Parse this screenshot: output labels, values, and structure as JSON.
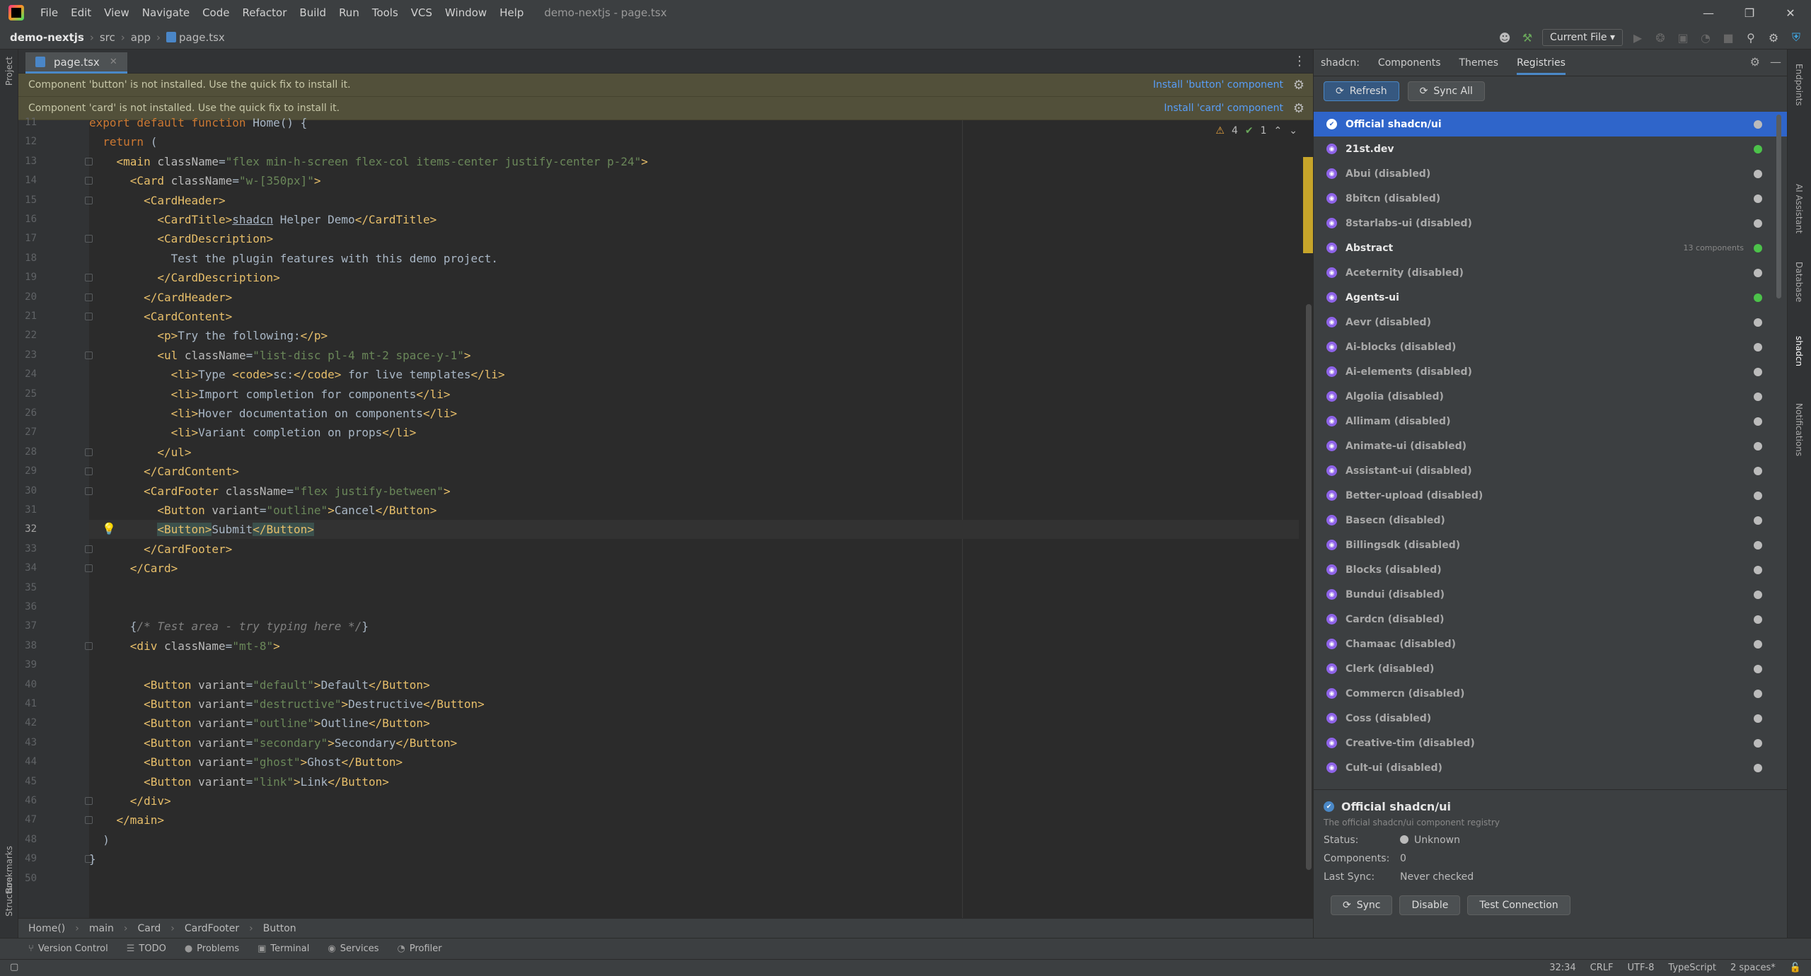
{
  "titlebar": {
    "menu": [
      "File",
      "Edit",
      "View",
      "Navigate",
      "Code",
      "Refactor",
      "Build",
      "Run",
      "Tools",
      "VCS",
      "Window",
      "Help"
    ],
    "title": "demo-nextjs - page.tsx"
  },
  "navbar": {
    "project": "demo-nextjs",
    "path": [
      "src",
      "app"
    ],
    "file": "page.tsx",
    "run_config": "Current File"
  },
  "left_strip": {
    "project": "Project",
    "bookmarks": "Bookmarks",
    "structure": "Structure"
  },
  "editor": {
    "tab": "page.tsx",
    "warnings": [
      {
        "text": "Component 'button' is not installed. Use the quick fix to install it.",
        "action": "Install 'button' component"
      },
      {
        "text": "Component 'card' is not installed. Use the quick fix to install it.",
        "action": "Install 'card' component"
      }
    ],
    "inspections": {
      "warnings": "4",
      "ok": "1"
    },
    "current_line": "32",
    "lines": [
      {
        "n": "11",
        "html": "<span class='kw'>export default function</span> <span class='tx'>Home() {</span>"
      },
      {
        "n": "12",
        "html": "  <span class='kw'>return</span> <span class='tx'>(</span>"
      },
      {
        "n": "13",
        "html": "    <span class='tg'>&lt;main</span> <span class='at'>className</span>=<span class='st'>\"flex min-h-screen flex-col items-center justify-center p-24\"</span><span class='tg'>&gt;</span>"
      },
      {
        "n": "14",
        "html": "      <span class='tg'>&lt;Card</span> <span class='at'>className</span>=<span class='st'>\"w-[350px]\"</span><span class='tg'>&gt;</span>"
      },
      {
        "n": "15",
        "html": "        <span class='tg'>&lt;CardHeader&gt;</span>"
      },
      {
        "n": "16",
        "html": "          <span class='tg'>&lt;CardTitle&gt;</span><span class='tx'><u>shadcn</u> Helper Demo</span><span class='tg'>&lt;/CardTitle&gt;</span>"
      },
      {
        "n": "17",
        "html": "          <span class='tg'>&lt;CardDescription&gt;</span>"
      },
      {
        "n": "18",
        "html": "            <span class='tx'>Test the plugin features with this demo project.</span>"
      },
      {
        "n": "19",
        "html": "          <span class='tg'>&lt;/CardDescription&gt;</span>"
      },
      {
        "n": "20",
        "html": "        <span class='tg'>&lt;/CardHeader&gt;</span>"
      },
      {
        "n": "21",
        "html": "        <span class='tg'>&lt;CardContent&gt;</span>"
      },
      {
        "n": "22",
        "html": "          <span class='tg'>&lt;p&gt;</span><span class='tx'>Try the following:</span><span class='tg'>&lt;/p&gt;</span>"
      },
      {
        "n": "23",
        "html": "          <span class='tg'>&lt;ul</span> <span class='at'>className</span>=<span class='st'>\"list-disc pl-4 mt-2 space-y-1\"</span><span class='tg'>&gt;</span>"
      },
      {
        "n": "24",
        "html": "            <span class='tg'>&lt;li&gt;</span><span class='tx'>Type </span><span class='tg'>&lt;code&gt;</span><span class='tx'>sc:</span><span class='tg'>&lt;/code&gt;</span><span class='tx'> for live templates</span><span class='tg'>&lt;/li&gt;</span>"
      },
      {
        "n": "25",
        "html": "            <span class='tg'>&lt;li&gt;</span><span class='tx'>Import completion for components</span><span class='tg'>&lt;/li&gt;</span>"
      },
      {
        "n": "26",
        "html": "            <span class='tg'>&lt;li&gt;</span><span class='tx'>Hover documentation on components</span><span class='tg'>&lt;/li&gt;</span>"
      },
      {
        "n": "27",
        "html": "            <span class='tg'>&lt;li&gt;</span><span class='tx'>Variant completion on props</span><span class='tg'>&lt;/li&gt;</span>"
      },
      {
        "n": "28",
        "html": "          <span class='tg'>&lt;/ul&gt;</span>"
      },
      {
        "n": "29",
        "html": "        <span class='tg'>&lt;/CardContent&gt;</span>"
      },
      {
        "n": "30",
        "html": "        <span class='tg'>&lt;CardFooter</span> <span class='at'>className</span>=<span class='st'>\"flex justify-between\"</span><span class='tg'>&gt;</span>"
      },
      {
        "n": "31",
        "html": "          <span class='tg'>&lt;Button</span> <span class='at'>variant</span>=<span class='st'>\"outline\"</span><span class='tg'>&gt;</span><span class='tx'>Cancel</span><span class='tg'>&lt;/Button&gt;</span>"
      },
      {
        "n": "32",
        "html": "          <span class='tg hl'>&lt;Button&gt;</span><span class='tx'>Submit</span><span class='tg hl'>&lt;/Button&gt;</span>"
      },
      {
        "n": "33",
        "html": "        <span class='tg'>&lt;/CardFooter&gt;</span>"
      },
      {
        "n": "34",
        "html": "      <span class='tg'>&lt;/Card&gt;</span>"
      },
      {
        "n": "35",
        "html": ""
      },
      {
        "n": "36",
        "html": ""
      },
      {
        "n": "37",
        "html": "      <span class='tx'>{</span><span class='cm'>/* Test area - try typing here */</span><span class='tx'>}</span>"
      },
      {
        "n": "38",
        "html": "      <span class='tg'>&lt;div</span> <span class='at'>className</span>=<span class='st'>\"mt-8\"</span><span class='tg'>&gt;</span>"
      },
      {
        "n": "39",
        "html": ""
      },
      {
        "n": "40",
        "html": "        <span class='tg'>&lt;Button</span> <span class='at'>variant</span>=<span class='st'>\"default\"</span><span class='tg'>&gt;</span><span class='tx'>Default</span><span class='tg'>&lt;/Button&gt;</span>"
      },
      {
        "n": "41",
        "html": "        <span class='tg'>&lt;Button</span> <span class='at'>variant</span>=<span class='st'>\"destructive\"</span><span class='tg'>&gt;</span><span class='tx'>Destructive</span><span class='tg'>&lt;/Button&gt;</span>"
      },
      {
        "n": "42",
        "html": "        <span class='tg'>&lt;Button</span> <span class='at'>variant</span>=<span class='st'>\"outline\"</span><span class='tg'>&gt;</span><span class='tx'>Outline</span><span class='tg'>&lt;/Button&gt;</span>"
      },
      {
        "n": "43",
        "html": "        <span class='tg'>&lt;Button</span> <span class='at'>variant</span>=<span class='st'>\"secondary\"</span><span class='tg'>&gt;</span><span class='tx'>Secondary</span><span class='tg'>&lt;/Button&gt;</span>"
      },
      {
        "n": "44",
        "html": "        <span class='tg'>&lt;Button</span> <span class='at'>variant</span>=<span class='st'>\"ghost\"</span><span class='tg'>&gt;</span><span class='tx'>Ghost</span><span class='tg'>&lt;/Button&gt;</span>"
      },
      {
        "n": "45",
        "html": "        <span class='tg'>&lt;Button</span> <span class='at'>variant</span>=<span class='st'>\"link\"</span><span class='tg'>&gt;</span><span class='tx'>Link</span><span class='tg'>&lt;/Button&gt;</span>"
      },
      {
        "n": "46",
        "html": "      <span class='tg'>&lt;/div&gt;</span>"
      },
      {
        "n": "47",
        "html": "    <span class='tg'>&lt;/main&gt;</span>"
      },
      {
        "n": "48",
        "html": "  <span class='tx'>)</span>"
      },
      {
        "n": "49",
        "html": "<span class='tx'>}</span>"
      },
      {
        "n": "50",
        "html": ""
      }
    ],
    "breadcrumb": [
      "Home()",
      "main",
      "Card",
      "CardFooter",
      "Button"
    ]
  },
  "toolwindows": [
    {
      "icon": "⑂",
      "label": "Version Control"
    },
    {
      "icon": "☰",
      "label": "TODO"
    },
    {
      "icon": "●",
      "label": "Problems"
    },
    {
      "icon": "▣",
      "label": "Terminal"
    },
    {
      "icon": "◉",
      "label": "Services"
    },
    {
      "icon": "◔",
      "label": "Profiler"
    }
  ],
  "status": {
    "position": "32:34",
    "line_sep": "CRLF",
    "encoding": "UTF-8",
    "lang": "TypeScript",
    "indent": "2 spaces*"
  },
  "shadcn": {
    "label": "shadcn:",
    "tabs": [
      "Components",
      "Themes",
      "Registries"
    ],
    "active_tab": "Registries",
    "refresh": "Refresh",
    "sync_all": "Sync All",
    "registries": [
      {
        "name": "Official shadcn/ui",
        "enabled": true,
        "selected": true,
        "status": "unknown"
      },
      {
        "name": "21st.dev",
        "enabled": true,
        "status": "ok"
      },
      {
        "name": "Abui (disabled)",
        "enabled": false
      },
      {
        "name": "8bitcn (disabled)",
        "enabled": false
      },
      {
        "name": "8starlabs-ui (disabled)",
        "enabled": false
      },
      {
        "name": "Abstract",
        "enabled": true,
        "status": "ok",
        "count": "13 components"
      },
      {
        "name": "Aceternity (disabled)",
        "enabled": false
      },
      {
        "name": "Agents-ui",
        "enabled": true,
        "status": "ok"
      },
      {
        "name": "Aevr (disabled)",
        "enabled": false
      },
      {
        "name": "Ai-blocks (disabled)",
        "enabled": false
      },
      {
        "name": "Ai-elements (disabled)",
        "enabled": false
      },
      {
        "name": "Algolia (disabled)",
        "enabled": false
      },
      {
        "name": "Allimam (disabled)",
        "enabled": false
      },
      {
        "name": "Animate-ui (disabled)",
        "enabled": false
      },
      {
        "name": "Assistant-ui (disabled)",
        "enabled": false
      },
      {
        "name": "Better-upload (disabled)",
        "enabled": false
      },
      {
        "name": "Basecn (disabled)",
        "enabled": false
      },
      {
        "name": "Billingsdk (disabled)",
        "enabled": false
      },
      {
        "name": "Blocks (disabled)",
        "enabled": false
      },
      {
        "name": "Bundui (disabled)",
        "enabled": false
      },
      {
        "name": "Cardcn (disabled)",
        "enabled": false
      },
      {
        "name": "Chamaac (disabled)",
        "enabled": false
      },
      {
        "name": "Clerk (disabled)",
        "enabled": false
      },
      {
        "name": "Commercn (disabled)",
        "enabled": false
      },
      {
        "name": "Coss (disabled)",
        "enabled": false
      },
      {
        "name": "Creative-tim (disabled)",
        "enabled": false
      },
      {
        "name": "Cult-ui (disabled)",
        "enabled": false
      }
    ],
    "details": {
      "name": "Official shadcn/ui",
      "desc": "The official shadcn/ui component registry",
      "status_label": "Status:",
      "status": "Unknown",
      "components_label": "Components:",
      "components": "0",
      "lastsync_label": "Last Sync:",
      "lastsync": "Never checked",
      "btn_sync": "Sync",
      "btn_disable": "Disable",
      "btn_test": "Test Connection"
    }
  },
  "right_strip": [
    "Endpoints",
    "AI Assistant",
    "Database",
    "shadcn",
    "Notifications"
  ]
}
